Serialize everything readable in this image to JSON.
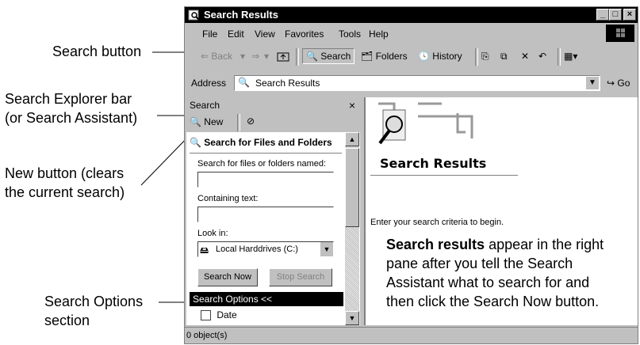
{
  "callouts": {
    "search_button": "Search button",
    "explorer_bar_line1": "Search Explorer bar",
    "explorer_bar_line2": "(or Search Assistant)",
    "new_button_line1": "New button (clears",
    "new_button_line2": "the current search)",
    "options_line1": "Search Options",
    "options_line2": "section"
  },
  "window": {
    "title": "Search Results",
    "min_label": "_",
    "max_label": "□",
    "close_label": "×"
  },
  "menu": [
    "File",
    "Edit",
    "View",
    "Favorites",
    "Tools",
    "Help"
  ],
  "toolbar": {
    "back": "⇐ Back",
    "forward": "⇒",
    "search": "Search",
    "folders": "Folders",
    "history": "History"
  },
  "address": {
    "label": "Address",
    "value": "Search Results",
    "go": "Go"
  },
  "search_pane": {
    "header": "Search",
    "close": "×",
    "new_label": "New",
    "section_title": "Search for Files and Folders",
    "named_label": "Search for files or folders named:",
    "named_value": "",
    "containing_label": "Containing text:",
    "containing_value": "",
    "lookin_label": "Look in:",
    "lookin_value": "Local Harddrives (C:)",
    "search_now": "Search Now",
    "stop_search": "Stop Search",
    "options_header": "Search Options  <<",
    "date_option": "Date"
  },
  "results": {
    "heading": "Search Results",
    "prompt": "Enter your search criteria to begin.",
    "note_bold": "Search results",
    "note_rest_1": " appear in the right",
    "note_line2": "pane after you tell the Search",
    "note_line3": "Assistant what to search for and",
    "note_line4": "then click the Search Now button."
  },
  "status": {
    "text": "0 object(s)"
  }
}
